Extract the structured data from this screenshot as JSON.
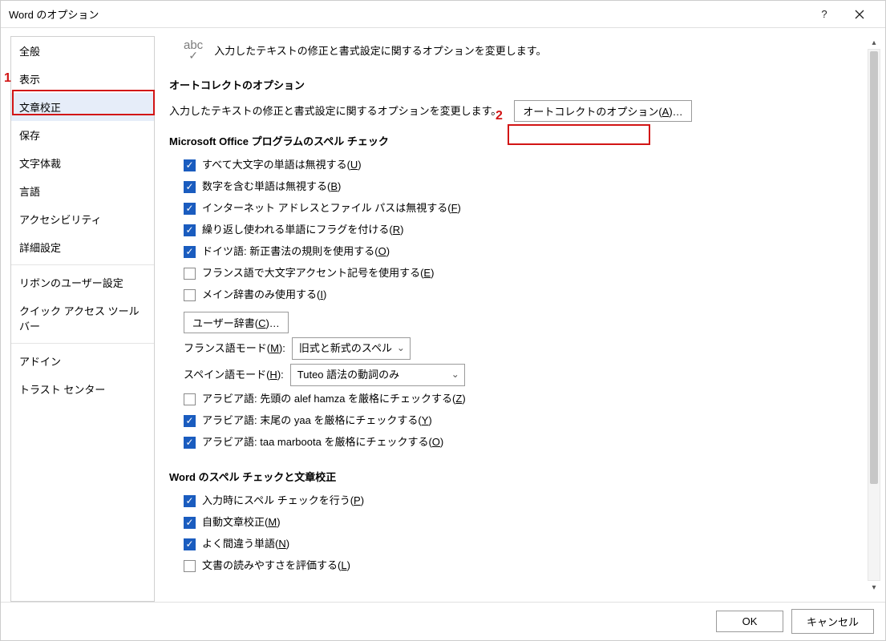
{
  "window": {
    "title": "Word のオプション"
  },
  "sidebar": {
    "items": [
      {
        "label": "全般"
      },
      {
        "label": "表示"
      },
      {
        "label": "文章校正",
        "selected": true
      },
      {
        "label": "保存"
      },
      {
        "label": "文字体裁"
      },
      {
        "label": "言語"
      },
      {
        "label": "アクセシビリティ"
      },
      {
        "label": "詳細設定"
      },
      {
        "label": "リボンのユーザー設定"
      },
      {
        "label": "クイック アクセス ツール バー"
      },
      {
        "label": "アドイン"
      },
      {
        "label": "トラスト センター"
      }
    ],
    "separators_after": [
      7,
      9
    ]
  },
  "header": {
    "desc": "入力したテキストの修正と書式設定に関するオプションを変更します。"
  },
  "autocorrect": {
    "section_title": "オートコレクトのオプション",
    "desc": "入力したテキストの修正と書式設定に関するオプションを変更します。",
    "button_label": "オートコレクトのオプション(",
    "button_ac": "A",
    "button_tail": ")…"
  },
  "spellcheck": {
    "section_title": "Microsoft Office プログラムのスペル チェック",
    "options": [
      {
        "checked": true,
        "label": "すべて大文字の単語は無視する(",
        "ac": "U",
        "tail": ")"
      },
      {
        "checked": true,
        "label": "数字を含む単語は無視する(",
        "ac": "B",
        "tail": ")"
      },
      {
        "checked": true,
        "label": "インターネット アドレスとファイル パスは無視する(",
        "ac": "F",
        "tail": ")"
      },
      {
        "checked": true,
        "label": "繰り返し使われる単語にフラグを付ける(",
        "ac": "R",
        "tail": ")"
      },
      {
        "checked": true,
        "label": "ドイツ語: 新正書法の規則を使用する(",
        "ac": "O",
        "tail": ")"
      },
      {
        "checked": false,
        "label": "フランス語で大文字アクセント記号を使用する(",
        "ac": "E",
        "tail": ")"
      },
      {
        "checked": false,
        "label": "メイン辞書のみ使用する(",
        "ac": "I",
        "tail": ")"
      }
    ],
    "user_dict_button": {
      "pre": "ユーザー辞書(",
      "ac": "C",
      "tail": ")…"
    },
    "french_mode": {
      "label_pre": "フランス語モード(",
      "ac": "M",
      "label_tail": "):",
      "value": "旧式と新式のスペル"
    },
    "spanish_mode": {
      "label_pre": "スペイン語モード(",
      "ac": "H",
      "label_tail": "):",
      "value": "Tuteo 語法の動詞のみ"
    },
    "arabic": [
      {
        "checked": false,
        "label": "アラビア語: 先頭の alef hamza を厳格にチェックする(",
        "ac": "Z",
        "tail": ")"
      },
      {
        "checked": true,
        "label": "アラビア語: 末尾の yaa を厳格にチェックする(",
        "ac": "Y",
        "tail": ")"
      },
      {
        "checked": true,
        "label": "アラビア語: taa marboota を厳格にチェックする(",
        "ac": "O",
        "tail": ")"
      }
    ]
  },
  "word_spell": {
    "section_title": "Word のスペル チェックと文章校正",
    "options": [
      {
        "checked": true,
        "label": "入力時にスペル チェックを行う(",
        "ac": "P",
        "tail": ")"
      },
      {
        "checked": true,
        "label": "自動文章校正(",
        "ac": "M",
        "tail": ")"
      },
      {
        "checked": true,
        "label": "よく間違う単語(",
        "ac": "N",
        "tail": ")"
      },
      {
        "checked": false,
        "label": "文書の読みやすさを評価する(",
        "ac": "L",
        "tail": ")"
      }
    ]
  },
  "footer": {
    "ok": "OK",
    "cancel": "キャンセル"
  },
  "annotations": {
    "one": "1",
    "two": "2"
  }
}
